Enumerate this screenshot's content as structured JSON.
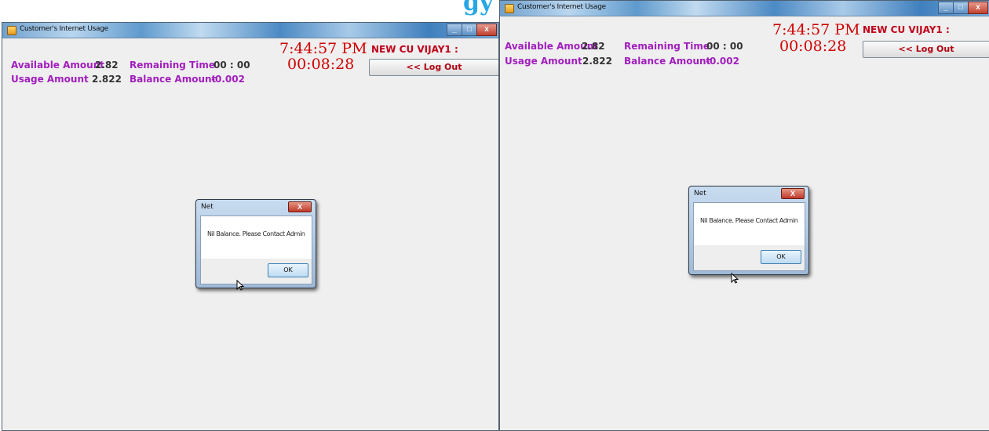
{
  "banner_fragment": "gy",
  "left_window": {
    "title": "Customer's Internet Usage",
    "available_label": "Available Amount",
    "available_value": "2.82",
    "usage_label": "Usage Amount",
    "usage_value": "2.822",
    "remaining_label": "Remaining Time",
    "remaining_value": "00 : 00",
    "balance_label": "Balance Amount",
    "balance_value": "-0.002",
    "clock_time": "7:44:57 PM",
    "clock_elapsed": "00:08:28",
    "user_label": "NEW CU VIJAY1 :",
    "logout_label": "<< Log Out",
    "dialog": {
      "title": "Net",
      "message": "Nil Balance. Please Contact Admin",
      "ok_label": "OK",
      "close_label": "X"
    }
  },
  "right_window": {
    "title": "Customer's Internet Usage",
    "available_label": "Available Amount",
    "available_value": "2.82",
    "usage_label": "Usage Amount",
    "usage_value": "2.822",
    "remaining_label": "Remaining Time",
    "remaining_value": "00 : 00",
    "balance_label": "Balance Amount",
    "balance_value": "-0.002",
    "clock_time": "7:44:57 PM",
    "clock_elapsed": "00:08:28",
    "user_label": "NEW CU VIJAY1 :",
    "logout_label": "<< Log Out",
    "dialog": {
      "title": "Net",
      "message": "Nil Balance. Please Contact Admin",
      "ok_label": "OK",
      "close_label": "X"
    }
  },
  "window_buttons": {
    "minimize": "_",
    "maximize": "□",
    "close": "x"
  },
  "colors": {
    "label_purple": "#a11ebd",
    "clock_red": "#d00000",
    "user_red": "#c0001a",
    "banner_blue": "#27a7e6"
  },
  "icons": [
    "app-icon",
    "minimize-icon",
    "maximize-icon",
    "close-icon",
    "mouse-cursor-icon"
  ]
}
